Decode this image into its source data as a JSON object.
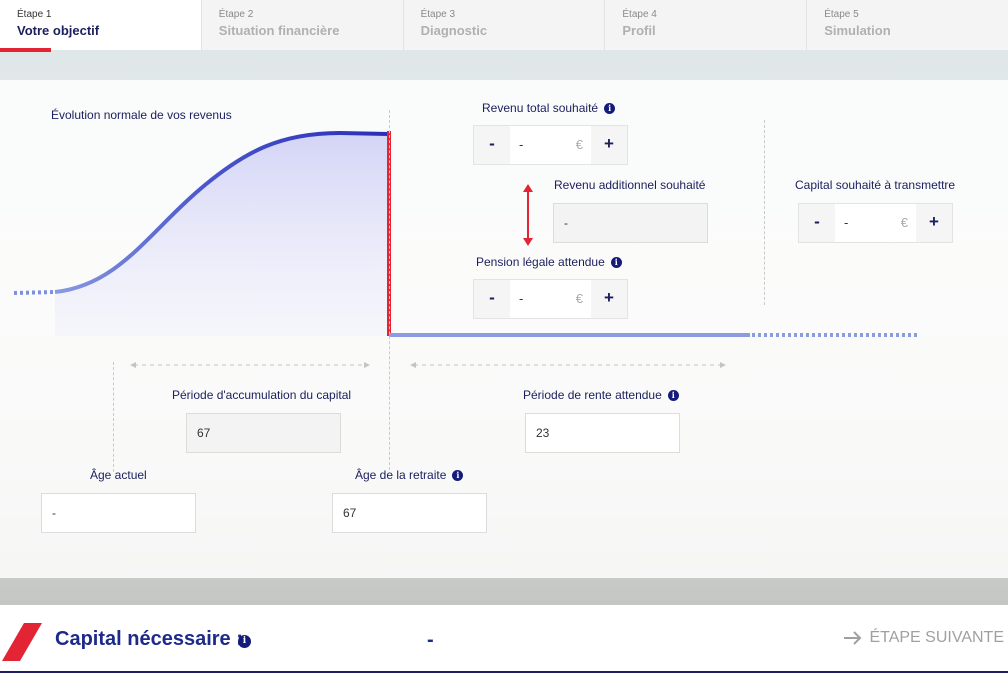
{
  "steps": [
    {
      "num": "Étape 1",
      "name": "Votre objectif"
    },
    {
      "num": "Étape 2",
      "name": "Situation financière"
    },
    {
      "num": "Étape 3",
      "name": "Diagnostic"
    },
    {
      "num": "Étape 4",
      "name": "Profil"
    },
    {
      "num": "Étape 5",
      "name": "Simulation"
    }
  ],
  "chart": {
    "title": "Évolution normale de vos revenus"
  },
  "revenu_total": {
    "label": "Revenu total souhaité",
    "minus": "-",
    "value": "-",
    "currency": "€",
    "plus": "+"
  },
  "revenu_add": {
    "label": "Revenu additionnel souhaité",
    "value": "-"
  },
  "pension": {
    "label": "Pension légale attendue",
    "minus": "-",
    "value": "-",
    "currency": "€",
    "plus": "+"
  },
  "capital_transmettre": {
    "label": "Capital souhaité à transmettre",
    "minus": "-",
    "value": "-",
    "currency": "€",
    "plus": "+"
  },
  "accumulation": {
    "label": "Période d'accumulation du capital",
    "value": "67"
  },
  "rente": {
    "label": "Période de rente attendue",
    "value": "23"
  },
  "age_actuel": {
    "label": "Âge actuel",
    "value": "-"
  },
  "age_retraite": {
    "label": "Âge de la retraite",
    "value": "67"
  },
  "bottom": {
    "capital_label": "Capital nécessaire :",
    "capital_value": "-",
    "next_label": "ÉTAPE SUIVANTE"
  },
  "colors": {
    "accent": "#e32434",
    "navy": "#1b1f5e",
    "curve": "#2a2db8"
  },
  "icons": {
    "info": "info-icon",
    "next": "arrow-right-icon",
    "logo": "brand-slash-icon"
  }
}
